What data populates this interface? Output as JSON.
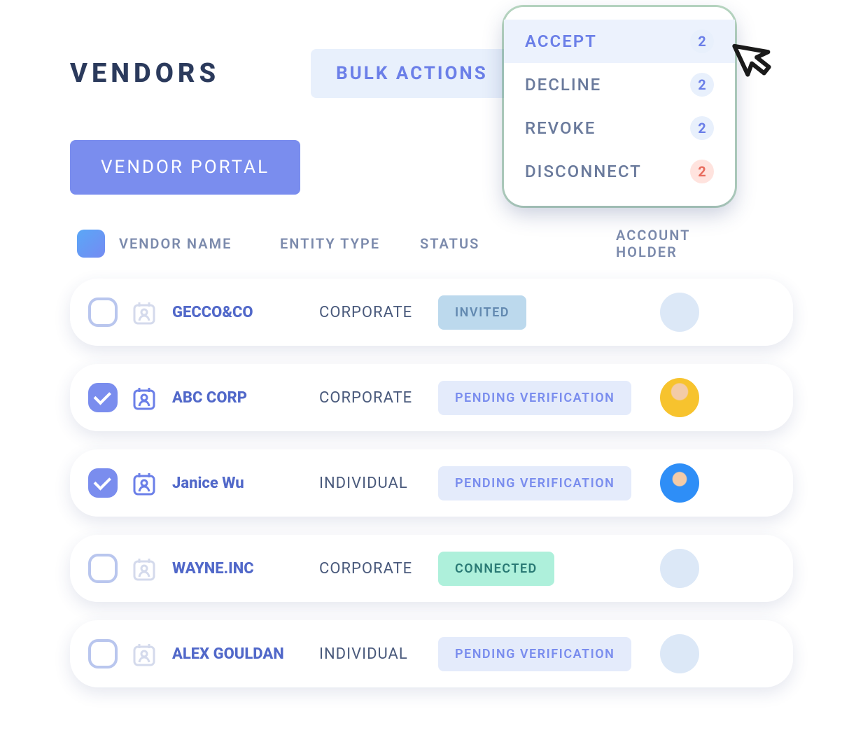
{
  "page": {
    "title": "VENDORS"
  },
  "bulk_actions": {
    "label": "BULK ACTIONS",
    "items": [
      {
        "label": "ACCEPT",
        "count": 2,
        "highlighted": true,
        "badge": "blue",
        "accent": true
      },
      {
        "label": "DECLINE",
        "count": 2,
        "highlighted": false,
        "badge": "blue",
        "accent": false
      },
      {
        "label": "REVOKE",
        "count": 2,
        "highlighted": false,
        "badge": "blue",
        "accent": false
      },
      {
        "label": "DISCONNECT",
        "count": 2,
        "highlighted": false,
        "badge": "red",
        "accent": false
      }
    ]
  },
  "vendor_portal_label": "VENDOR PORTAL",
  "columns": {
    "vendor_name": "VENDOR NAME",
    "entity_type": "ENTITY TYPE",
    "status": "STATUS",
    "account_holder": "ACCOUNT HOLDER"
  },
  "rows": [
    {
      "checked": false,
      "name": "GECCO&CO",
      "entity": "CORPORATE",
      "status": "INVITED",
      "status_class": "status-invited",
      "avatar": "none",
      "icon_active": false
    },
    {
      "checked": true,
      "name": "ABC CORP",
      "entity": "CORPORATE",
      "status": "PENDING VERIFICATION",
      "status_class": "status-pending",
      "avatar": "yellow",
      "icon_active": true
    },
    {
      "checked": true,
      "name": "Janice Wu",
      "entity": "INDIVIDUAL",
      "status": "PENDING VERIFICATION",
      "status_class": "status-pending",
      "avatar": "bluebg",
      "icon_active": true
    },
    {
      "checked": false,
      "name": "WAYNE.INC",
      "entity": "CORPORATE",
      "status": "CONNECTED",
      "status_class": "status-connected",
      "avatar": "none",
      "icon_active": false
    },
    {
      "checked": false,
      "name": "ALEX GOULDAN",
      "entity": "INDIVIDUAL",
      "status": "PENDING VERIFICATION",
      "status_class": "status-pending",
      "avatar": "none",
      "icon_active": false
    }
  ]
}
